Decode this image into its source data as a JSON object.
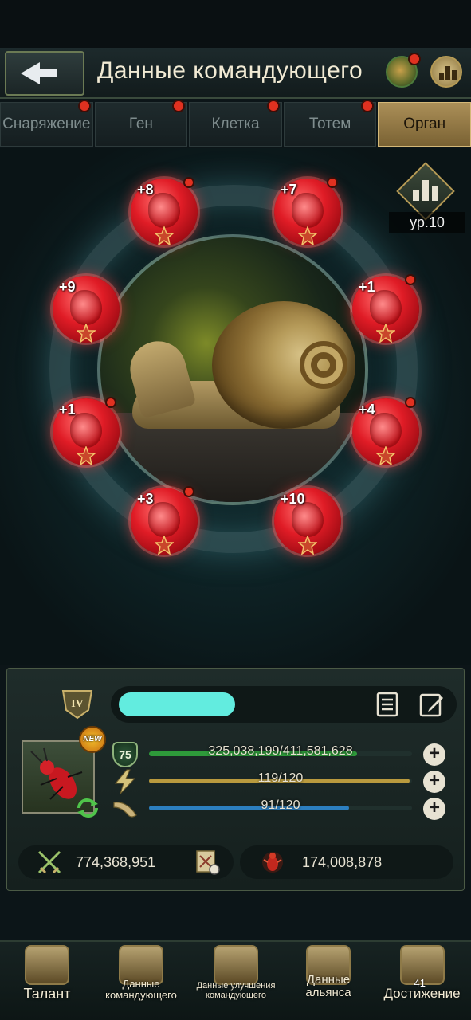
{
  "header": {
    "title": "Данные командующего"
  },
  "tabs": [
    {
      "label": "Снаряжение",
      "active": false
    },
    {
      "label": "Ген",
      "active": false
    },
    {
      "label": "Клетка",
      "active": false
    },
    {
      "label": "Тотем",
      "active": false
    },
    {
      "label": "Орган",
      "active": true
    }
  ],
  "organs": [
    {
      "level": "+8"
    },
    {
      "level": "+7"
    },
    {
      "level": "+9"
    },
    {
      "level": "+1"
    },
    {
      "level": "+1"
    },
    {
      "level": "+4"
    },
    {
      "level": "+3"
    },
    {
      "level": "+10"
    }
  ],
  "organ_level_badge": "ур.10",
  "commander": {
    "rank_numeral": "IV",
    "new_badge": "NEW",
    "level": "75",
    "exp": "325,038,199/411,581,628",
    "exp_fraction": 0.79,
    "stamina": "119/120",
    "stamina_fraction": 0.99,
    "food": "91/120",
    "food_fraction": 0.76,
    "power": "774,368,951",
    "kills": "174,008,878"
  },
  "bottom_nav": {
    "talent": "Талант",
    "commander_data": "Данные командующего",
    "upgrade_data": "Данные улучшения командующего",
    "alliance_data": "Данные альянса",
    "achievement": "Достижение",
    "achievement_count": "41"
  },
  "colors": {
    "exp_bar": "#2e9a3a",
    "stamina_bar": "#b99a3e",
    "food_bar": "#2c7fc0",
    "accent_gold": "#ab8f58",
    "notification": "#e03120",
    "name_blob": "#62ecdf"
  }
}
